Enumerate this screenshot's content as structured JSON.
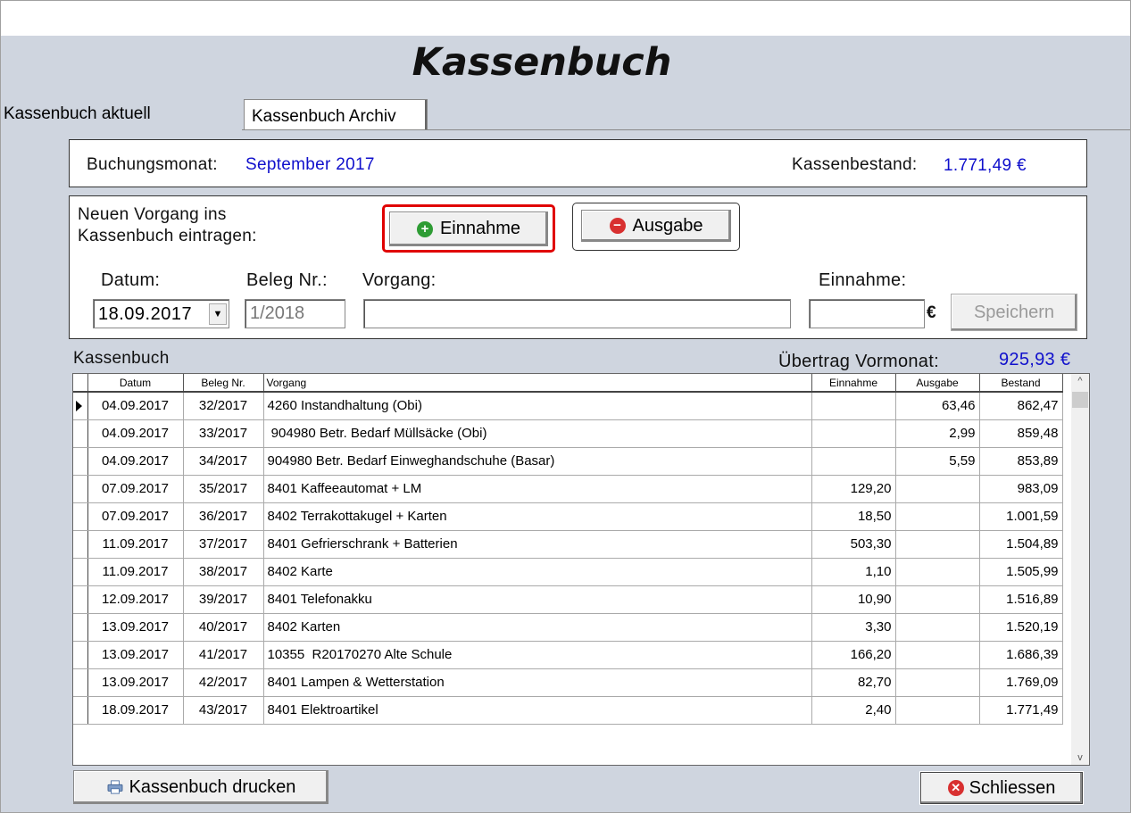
{
  "app": {
    "title": "Kassenbuch"
  },
  "tabs": [
    {
      "label": "Kassenbuch aktuell",
      "active": true
    },
    {
      "label": "Kassenbuch Archiv",
      "active": false
    }
  ],
  "summary": {
    "month_label": "Buchungsmonat:",
    "month_value": "September 2017",
    "balance_label": "Kassenbestand:",
    "balance_value": "1.771,49 €"
  },
  "entry": {
    "intro_line1": "Neuen Vorgang ins",
    "intro_line2": "Kassenbuch eintragen:",
    "einnahme_button": "Einnahme",
    "ausgabe_button": "Ausgabe",
    "datum_label": "Datum:",
    "beleg_label": "Beleg Nr.:",
    "vorgang_label": "Vorgang:",
    "einnahme_label": "Einnahme:",
    "datum_value": "18.09.2017",
    "beleg_value": "1/2018",
    "vorgang_value": "",
    "einnahme_value": "",
    "currency": "€",
    "save_button": "Speichern"
  },
  "ledger": {
    "title": "Kassenbuch",
    "carry_label": "Übertrag Vormonat:",
    "carry_value": "925,93 €",
    "columns": [
      "Datum",
      "Beleg Nr.",
      "Vorgang",
      "Einnahme",
      "Ausgabe",
      "Bestand"
    ],
    "rows": [
      {
        "datum": "04.09.2017",
        "beleg": "32/2017",
        "vorgang": "4260 Instandhaltung (Obi)",
        "einnahme": "",
        "ausgabe": "63,46",
        "bestand": "862,47",
        "current": true
      },
      {
        "datum": "04.09.2017",
        "beleg": "33/2017",
        "vorgang": " 904980 Betr. Bedarf Müllsäcke (Obi)",
        "einnahme": "",
        "ausgabe": "2,99",
        "bestand": "859,48"
      },
      {
        "datum": "04.09.2017",
        "beleg": "34/2017",
        "vorgang": "904980 Betr. Bedarf Einweghandschuhe (Basar)",
        "einnahme": "",
        "ausgabe": "5,59",
        "bestand": "853,89"
      },
      {
        "datum": "07.09.2017",
        "beleg": "35/2017",
        "vorgang": "8401 Kaffeeautomat + LM",
        "einnahme": "129,20",
        "ausgabe": "",
        "bestand": "983,09"
      },
      {
        "datum": "07.09.2017",
        "beleg": "36/2017",
        "vorgang": "8402 Terrakottakugel + Karten",
        "einnahme": "18,50",
        "ausgabe": "",
        "bestand": "1.001,59"
      },
      {
        "datum": "11.09.2017",
        "beleg": "37/2017",
        "vorgang": "8401 Gefrierschrank + Batterien",
        "einnahme": "503,30",
        "ausgabe": "",
        "bestand": "1.504,89"
      },
      {
        "datum": "11.09.2017",
        "beleg": "38/2017",
        "vorgang": "8402 Karte",
        "einnahme": "1,10",
        "ausgabe": "",
        "bestand": "1.505,99"
      },
      {
        "datum": "12.09.2017",
        "beleg": "39/2017",
        "vorgang": "8401 Telefonakku",
        "einnahme": "10,90",
        "ausgabe": "",
        "bestand": "1.516,89"
      },
      {
        "datum": "13.09.2017",
        "beleg": "40/2017",
        "vorgang": "8402 Karten",
        "einnahme": "3,30",
        "ausgabe": "",
        "bestand": "1.520,19"
      },
      {
        "datum": "13.09.2017",
        "beleg": "41/2017",
        "vorgang": "10355  R20170270 Alte Schule",
        "einnahme": "166,20",
        "ausgabe": "",
        "bestand": "1.686,39"
      },
      {
        "datum": "13.09.2017",
        "beleg": "42/2017",
        "vorgang": "8401 Lampen & Wetterstation",
        "einnahme": "82,70",
        "ausgabe": "",
        "bestand": "1.769,09"
      },
      {
        "datum": "18.09.2017",
        "beleg": "43/2017",
        "vorgang": "8401 Elektroartikel",
        "einnahme": "2,40",
        "ausgabe": "",
        "bestand": "1.771,49"
      }
    ]
  },
  "footer": {
    "print_button": "Kassenbuch drucken",
    "close_button": "Schliessen"
  },
  "icons": {
    "add": "plus-circle-icon",
    "remove": "minus-circle-icon",
    "printer": "printer-icon",
    "close": "close-circle-icon",
    "dropdown": "chevron-down-icon"
  },
  "colors": {
    "accent_blue": "#1010cc",
    "panel_bg": "#cfd5df",
    "highlight_red": "#e00000"
  }
}
